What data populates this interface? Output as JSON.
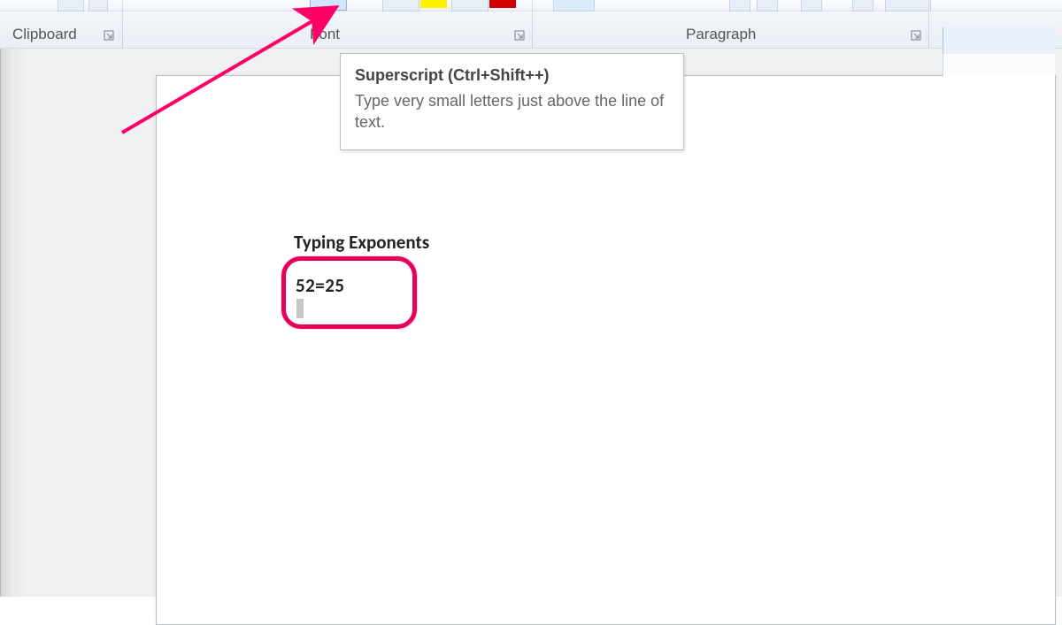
{
  "ribbon": {
    "groups": {
      "clipboard": {
        "label": "Clipboard"
      },
      "font": {
        "label": "Font"
      },
      "paragraph": {
        "label": "Paragraph"
      }
    }
  },
  "tooltip": {
    "title": "Superscript (Ctrl+Shift++)",
    "body": "Type very small letters just above the line of text."
  },
  "document": {
    "heading": "Typing Exponents",
    "equation": "52=25"
  },
  "colors": {
    "highlight_pink": "#e6005a",
    "swatch_yellow": "#fff200",
    "swatch_red": "#d30000",
    "selected_button": "#cfe5fb"
  }
}
